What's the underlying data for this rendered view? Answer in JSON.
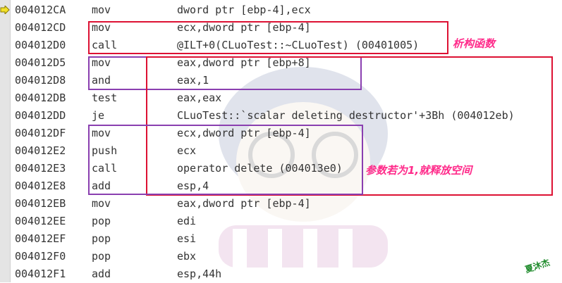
{
  "disassembly": {
    "rows": [
      {
        "addr": "004012CA",
        "mnemonic": "mov",
        "operands": "dword ptr [ebp-4],ecx",
        "current": true
      },
      {
        "addr": "004012CD",
        "mnemonic": "mov",
        "operands": "ecx,dword ptr [ebp-4]"
      },
      {
        "addr": "004012D0",
        "mnemonic": "call",
        "operands": "@ILT+0(CLuoTest::~CLuoTest) (00401005)"
      },
      {
        "addr": "004012D5",
        "mnemonic": "mov",
        "operands": "eax,dword ptr [ebp+8]"
      },
      {
        "addr": "004012D8",
        "mnemonic": "and",
        "operands": "eax,1"
      },
      {
        "addr": "004012DB",
        "mnemonic": "test",
        "operands": "eax,eax"
      },
      {
        "addr": "004012DD",
        "mnemonic": "je",
        "operands": "CLuoTest::`scalar deleting destructor'+3Bh (004012eb)"
      },
      {
        "addr": "004012DF",
        "mnemonic": "mov",
        "operands": "ecx,dword ptr [ebp-4]"
      },
      {
        "addr": "004012E2",
        "mnemonic": "push",
        "operands": "ecx"
      },
      {
        "addr": "004012E3",
        "mnemonic": "call",
        "operands": "operator delete (004013e0)"
      },
      {
        "addr": "004012E8",
        "mnemonic": "add",
        "operands": "esp,4"
      },
      {
        "addr": "004012EB",
        "mnemonic": "mov",
        "operands": "eax,dword ptr [ebp-4]"
      },
      {
        "addr": "004012EE",
        "mnemonic": "pop",
        "operands": "edi"
      },
      {
        "addr": "004012EF",
        "mnemonic": "pop",
        "operands": "esi"
      },
      {
        "addr": "004012F0",
        "mnemonic": "pop",
        "operands": "ebx"
      },
      {
        "addr": "004012F1",
        "mnemonic": "add",
        "operands": "esp,44h"
      }
    ]
  },
  "annotations": {
    "destructor_note": "析构函数",
    "free_note": "参数若为1,就释放空间"
  },
  "watermark": {
    "signature": "夏沐杰"
  },
  "colors": {
    "text": "#333333",
    "box_red": "#dd1133",
    "box_purple": "#8a3fb0",
    "note_pink": "#ff2a8a",
    "arrow": "#f2e12a"
  }
}
